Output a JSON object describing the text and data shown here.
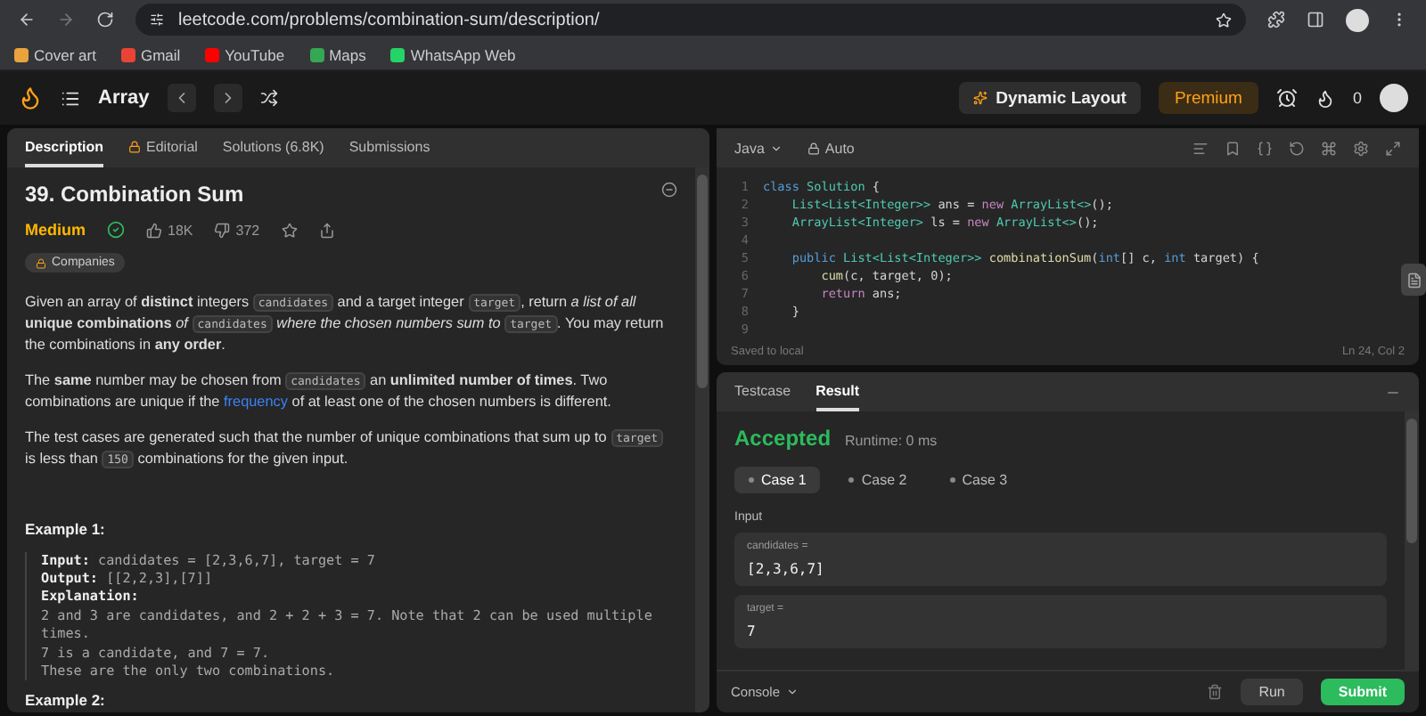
{
  "browser": {
    "url": "leetcode.com/problems/combination-sum/description/",
    "bookmarks": [
      "Cover art",
      "Gmail",
      "YouTube",
      "Maps",
      "WhatsApp Web"
    ]
  },
  "nav": {
    "list_title": "Array",
    "dynamic_layout": "Dynamic Layout",
    "premium": "Premium",
    "streak": "0"
  },
  "left_tabs": [
    {
      "label": "Description",
      "selected": true,
      "locked": false
    },
    {
      "label": "Editorial",
      "selected": false,
      "locked": true
    },
    {
      "label": "Solutions (6.8K)",
      "selected": false,
      "locked": false
    },
    {
      "label": "Submissions",
      "selected": false,
      "locked": false
    }
  ],
  "problem": {
    "title": "39. Combination Sum",
    "difficulty": "Medium",
    "solved": true,
    "likes": "18K",
    "dislikes": "372",
    "companies": "Companies",
    "paragraphs": [
      [
        {
          "kind": "text",
          "text": "Given an array of **distinct** integers "
        },
        {
          "kind": "code",
          "text": "candidates"
        },
        {
          "kind": "text",
          "text": " and a target integer "
        },
        {
          "kind": "code",
          "text": "target"
        },
        {
          "kind": "text",
          "text": ", return *a list of all* **unique combinations** *of* "
        },
        {
          "kind": "code",
          "text": "candidates"
        },
        {
          "kind": "text",
          "text": " *where the chosen numbers sum to* "
        },
        {
          "kind": "code",
          "text": "target"
        },
        {
          "kind": "text",
          "text": ". You may return the combinations in **any order**."
        }
      ],
      [
        {
          "kind": "text",
          "text": "The **same** number may be chosen from "
        },
        {
          "kind": "code",
          "text": "candidates"
        },
        {
          "kind": "text",
          "text": " an **unlimited number of times**. Two combinations are unique if the "
        },
        {
          "kind": "link",
          "text": "frequency"
        },
        {
          "kind": "text",
          "text": " of at least one of the chosen numbers is different."
        }
      ],
      [
        {
          "kind": "text",
          "text": "The test cases are generated such that the number of unique combinations that sum up to "
        },
        {
          "kind": "code",
          "text": "target"
        },
        {
          "kind": "text",
          "text": " is less than "
        },
        {
          "kind": "code",
          "text": "150"
        },
        {
          "kind": "text",
          "text": " combinations for the given input."
        }
      ]
    ],
    "examples": [
      {
        "title": "Example 1:",
        "lines": [
          {
            "label": "Input:",
            "text": "candidates = [2,3,6,7], target = 7"
          },
          {
            "label": "Output:",
            "text": "[[2,2,3],[7]]"
          },
          {
            "label": "Explanation:"
          },
          {
            "text": "2 and 3 are candidates, and 2 + 2 + 3 = 7. Note that 2 can be used multiple times."
          },
          {
            "text": "7 is a candidate, and 7 = 7."
          },
          {
            "text": "These are the only two combinations."
          }
        ]
      },
      {
        "title": "Example 2:"
      }
    ]
  },
  "editor": {
    "language": "Java",
    "mode": "Auto",
    "status": "Saved to local",
    "cursor": "Ln 24, Col 2",
    "lines": [
      {
        "number": "1",
        "tokens": [
          {
            "kind": "keyword",
            "text": "class"
          },
          {
            "kind": "type",
            "text": " Solution"
          },
          {
            "kind": "plain",
            "text": " {"
          }
        ]
      },
      {
        "number": "2",
        "tokens": [
          {
            "kind": "type",
            "text": "    List<List<Integer>>"
          },
          {
            "kind": "plain",
            "text": " ans = "
          },
          {
            "kind": "control",
            "text": "new"
          },
          {
            "kind": "type",
            "text": " ArrayList<>"
          },
          {
            "kind": "plain",
            "text": "();"
          }
        ]
      },
      {
        "number": "3",
        "tokens": [
          {
            "kind": "type",
            "text": "    ArrayList<Integer>"
          },
          {
            "kind": "plain",
            "text": " ls = "
          },
          {
            "kind": "control",
            "text": "new"
          },
          {
            "kind": "type",
            "text": " ArrayList<>"
          },
          {
            "kind": "plain",
            "text": "();"
          }
        ]
      },
      {
        "number": "4"
      },
      {
        "number": "5",
        "tokens": [
          {
            "kind": "keyword",
            "text": "    public"
          },
          {
            "kind": "type",
            "text": " List<List<Integer>>"
          },
          {
            "kind": "function",
            "text": " combinationSum"
          },
          {
            "kind": "plain",
            "text": "("
          },
          {
            "kind": "keyword",
            "text": "int"
          },
          {
            "kind": "plain",
            "text": "[] c, "
          },
          {
            "kind": "keyword",
            "text": "int"
          },
          {
            "kind": "plain",
            "text": " target) {"
          }
        ]
      },
      {
        "number": "6",
        "tokens": [
          {
            "kind": "function",
            "text": "        cum"
          },
          {
            "kind": "plain",
            "text": "(c, target, 0);"
          }
        ]
      },
      {
        "number": "7",
        "tokens": [
          {
            "kind": "control",
            "text": "        return"
          },
          {
            "kind": "plain",
            "text": " ans;"
          }
        ]
      },
      {
        "number": "8",
        "tokens": [
          {
            "kind": "plain",
            "text": "    }"
          }
        ]
      },
      {
        "number": "9"
      }
    ]
  },
  "result_tabs": [
    {
      "label": "Testcase",
      "selected": false
    },
    {
      "label": "Result",
      "selected": true
    }
  ],
  "result": {
    "status": "Accepted",
    "runtime": "Runtime: 0 ms",
    "cases": [
      {
        "label": "Case 1",
        "selected": true
      },
      {
        "label": "Case 2",
        "selected": false
      },
      {
        "label": "Case 3",
        "selected": false
      }
    ],
    "input_label": "Input",
    "inputs": [
      {
        "name": "candidates =",
        "value": "[2,3,6,7]"
      },
      {
        "name": "target =",
        "value": "7"
      }
    ]
  },
  "footer": {
    "console": "Console",
    "run": "Run",
    "submit": "Submit"
  }
}
